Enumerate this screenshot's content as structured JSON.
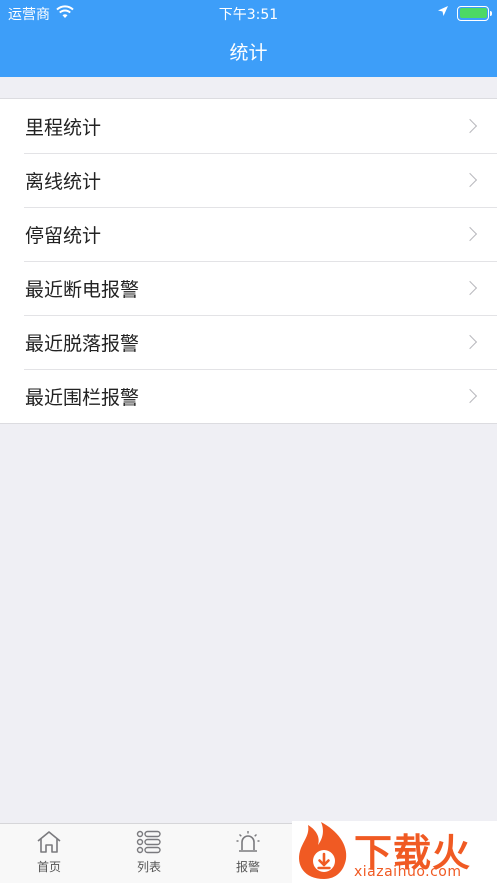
{
  "status_bar": {
    "carrier": "运营商",
    "time": "下午3:51"
  },
  "nav": {
    "title": "统计"
  },
  "menu": [
    {
      "label": "里程统计"
    },
    {
      "label": "离线统计"
    },
    {
      "label": "停留统计"
    },
    {
      "label": "最近断电报警"
    },
    {
      "label": "最近脱落报警"
    },
    {
      "label": "最近围栏报警"
    }
  ],
  "tabs": [
    {
      "label": "首页",
      "icon": "home-icon"
    },
    {
      "label": "列表",
      "icon": "list-icon"
    },
    {
      "label": "报警",
      "icon": "alarm-icon"
    }
  ],
  "watermark": {
    "brand": "下载火",
    "domain": "xiazaihuo.com"
  },
  "colors": {
    "nav_background": "#3d9ef9",
    "page_background": "#efeff4",
    "watermark": "#f05a23"
  }
}
